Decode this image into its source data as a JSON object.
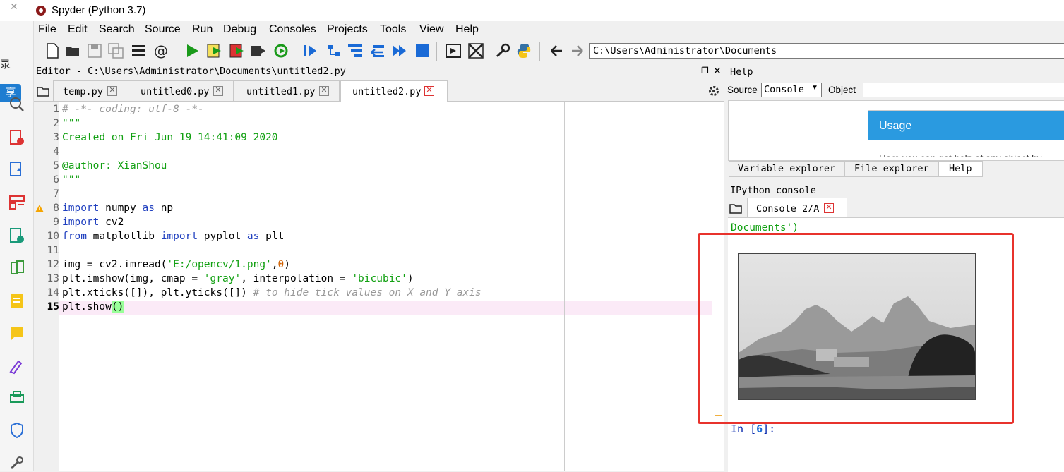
{
  "window": {
    "title": "Spyder (Python 3.7)"
  },
  "left_strip": {
    "text1": "录",
    "button": "享"
  },
  "menu": [
    "File",
    "Edit",
    "Search",
    "Source",
    "Run",
    "Debug",
    "Consoles",
    "Projects",
    "Tools",
    "View",
    "Help"
  ],
  "toolbar": {
    "path": "C:\\Users\\Administrator\\Documents"
  },
  "editor": {
    "title": "Editor - C:\\Users\\Administrator\\Documents\\untitled2.py",
    "tabs": [
      {
        "label": "temp.py"
      },
      {
        "label": "untitled0.py"
      },
      {
        "label": "untitled1.py"
      },
      {
        "label": "untitled2.py"
      }
    ],
    "line_numbers": [
      "1",
      "2",
      "3",
      "4",
      "5",
      "6",
      "7",
      "8",
      "9",
      "10",
      "11",
      "12",
      "13",
      "14",
      "15"
    ]
  },
  "help": {
    "title": "Help",
    "source_label": "Source",
    "source_value": "Console",
    "object_label": "Object",
    "usage_title": "Usage",
    "usage_text": "Here you can get help of any object by"
  },
  "pane_tabs": [
    "Variable explorer",
    "File explorer",
    "Help"
  ],
  "ipython": {
    "title": "IPython console",
    "tab": "Console 2/A",
    "output_line": "Documents')",
    "prompt_in": "In [",
    "prompt_num": "6",
    "prompt_end": "]:"
  },
  "colors": {
    "accent_blue": "#2a9ae0",
    "annotation_red": "#e8322c",
    "string_green": "#11a011",
    "keyword_blue": "#1f3fbf"
  }
}
